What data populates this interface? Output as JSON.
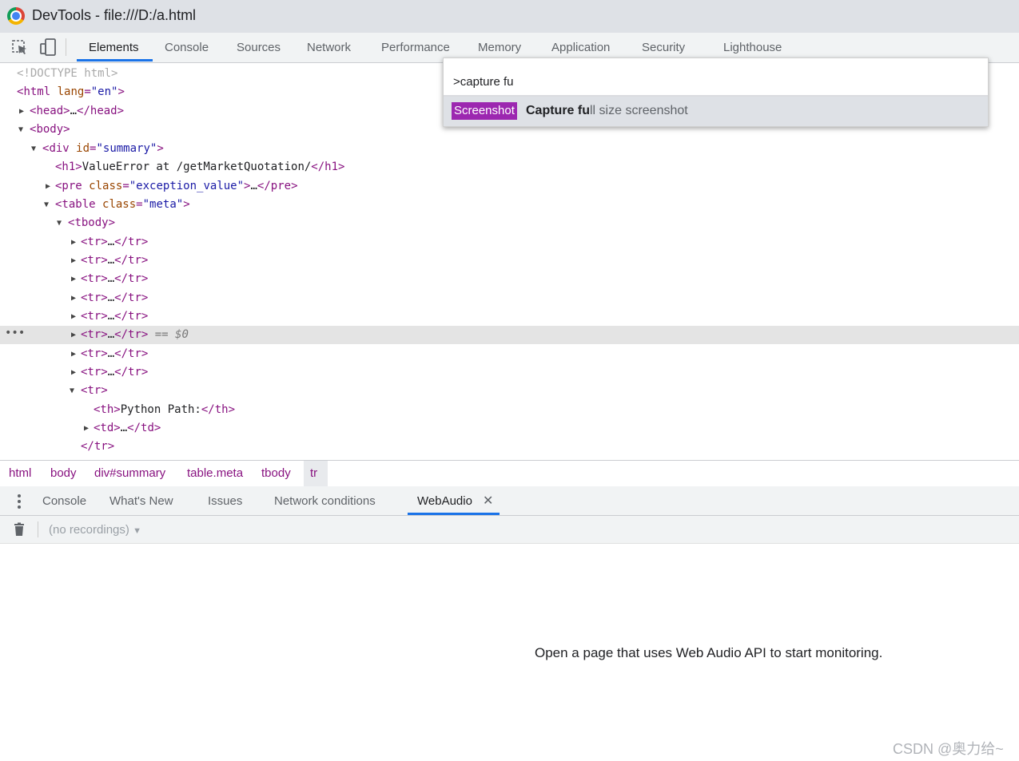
{
  "window": {
    "title": "DevTools - file:///D:/a.html"
  },
  "toolbar": {
    "tabs": [
      "Elements",
      "Console",
      "Sources",
      "Network",
      "Performance",
      "Memory",
      "Application",
      "Security",
      "Lighthouse"
    ],
    "active_tab": "Elements"
  },
  "command_menu": {
    "input": ">capture fu",
    "result_badge": "Screenshot",
    "result_match": "Capture fu",
    "result_rest": "ll size screenshot",
    "badge_color": "#9c27b0"
  },
  "dom_tree": {
    "doctype": "<!DOCTYPE html>",
    "html_open": "html",
    "html_attr": "lang",
    "html_attr_val": "\"en\"",
    "head": "head",
    "body": "body",
    "div": "div",
    "div_attr": "id",
    "div_attr_val": "\"summary\"",
    "h1_text": "ValueError at /getMarketQuotation/",
    "pre_attr_val": "\"exception_value\"",
    "table_attr_val": "\"meta\"",
    "tbody": "tbody",
    "th_text": "Python Path:",
    "selected_marker": "== $0",
    "ellipsis": "…"
  },
  "breadcrumb": [
    "html",
    "body",
    "div#summary",
    "table.meta",
    "tbody",
    "tr"
  ],
  "drawer": {
    "tabs": [
      "Console",
      "What's New",
      "Issues",
      "Network conditions",
      "WebAudio"
    ],
    "active_tab": "WebAudio",
    "recordings_placeholder": "(no recordings)",
    "empty_message": "Open a page that uses Web Audio API to start monitoring."
  },
  "watermark": "CSDN @奥力给~",
  "colors": {
    "accent": "#1a73e8",
    "tag": "#881280",
    "attr": "#994500",
    "value": "#1a1aa6"
  }
}
